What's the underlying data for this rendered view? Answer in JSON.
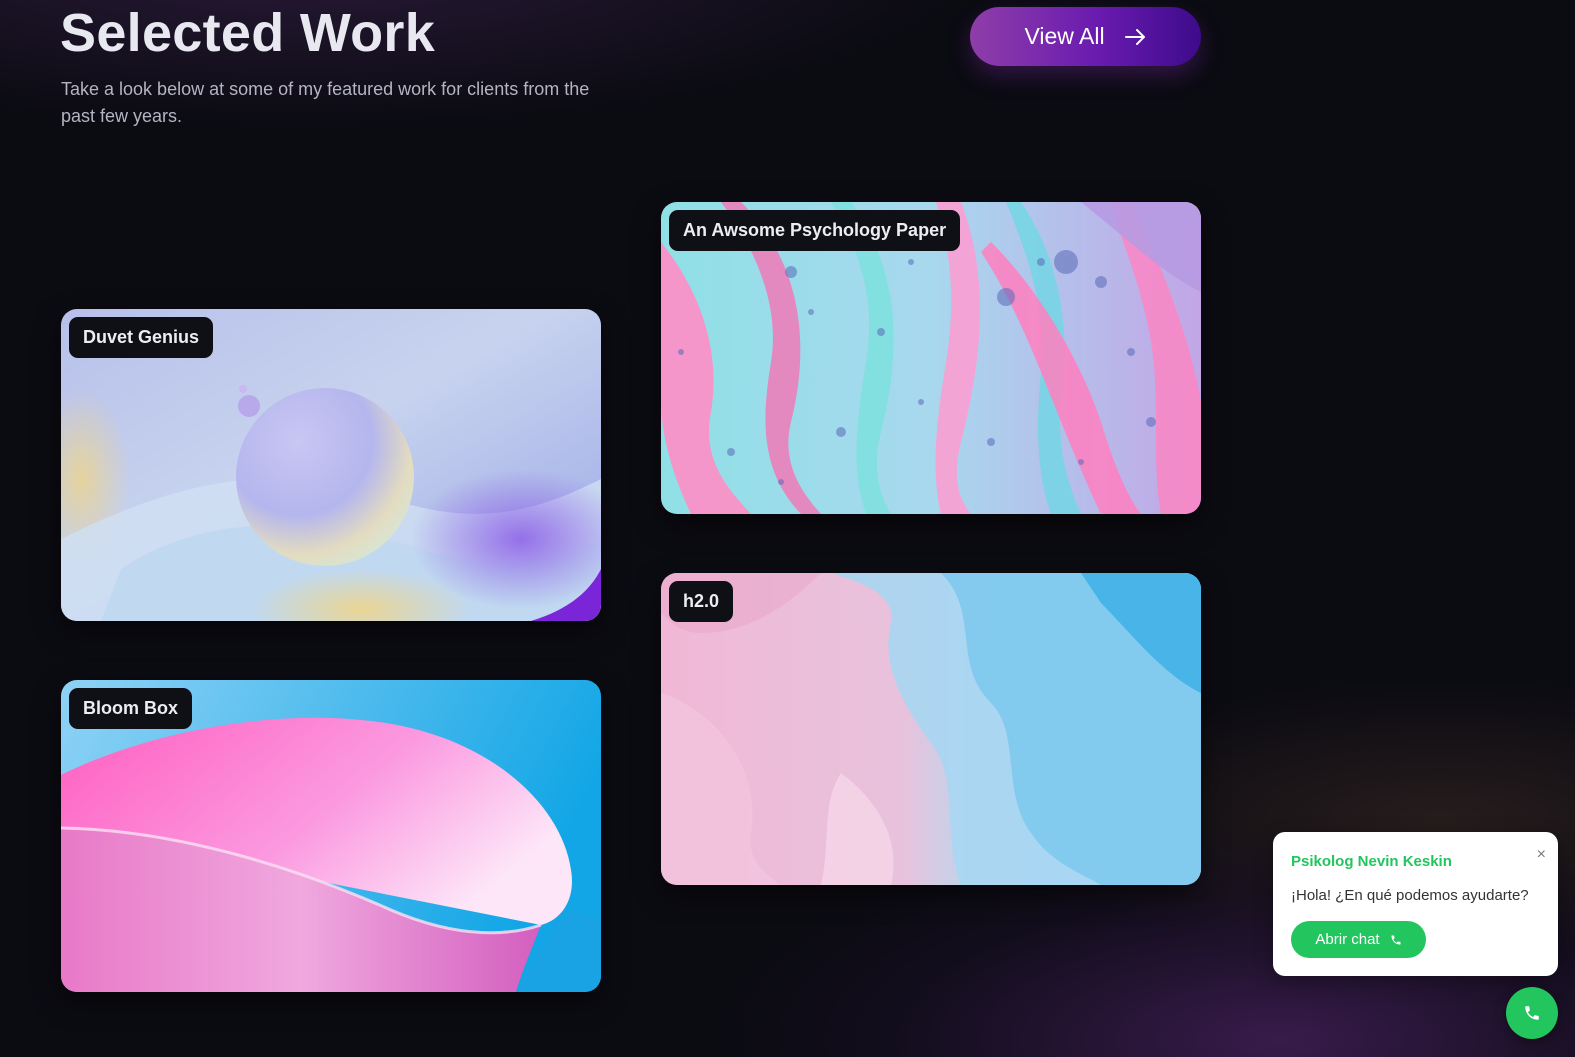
{
  "header": {
    "title": "Selected Work",
    "subtitle": "Take a look below at some of my featured work for clients from the past few years.",
    "view_all_label": "View All",
    "view_all_icon": "arrow-right-icon"
  },
  "projects": [
    {
      "label": "Duvet Genius"
    },
    {
      "label": "An Awsome Psychology Paper"
    },
    {
      "label": "h2.0"
    },
    {
      "label": "Bloom Box"
    }
  ],
  "chat_widget": {
    "name": "Psikolog Nevin Keskin",
    "close_icon": "×",
    "message": "¡Hola! ¿En qué podemos ayudarte?",
    "button_label": "Abrir chat",
    "button_icon": "phone-icon",
    "fab_icon": "phone-icon",
    "accent_color": "#22c55e"
  },
  "colors": {
    "background": "#0b0b12",
    "view_all_gradient": [
      "#8e3ea8",
      "#3d0b8a"
    ]
  }
}
